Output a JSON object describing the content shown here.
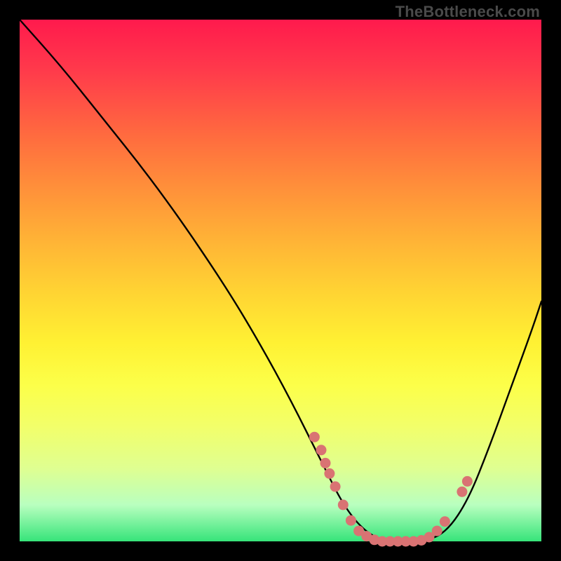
{
  "watermark": "TheBottleneck.com",
  "chart_data": {
    "type": "line",
    "title": "",
    "xlabel": "",
    "ylabel": "",
    "xlim": [
      0,
      100
    ],
    "ylim": [
      0,
      100
    ],
    "series": [
      {
        "name": "bottleneck-curve",
        "x": [
          0,
          8,
          16,
          24,
          32,
          40,
          46,
          52,
          58,
          62,
          66,
          70,
          74,
          78,
          82,
          86,
          90,
          94,
          98,
          100
        ],
        "y": [
          100,
          91,
          81,
          71,
          60,
          48,
          38,
          27,
          15,
          7,
          2,
          0,
          0,
          0,
          2,
          8,
          18,
          29,
          40,
          46
        ]
      }
    ],
    "markers": {
      "name": "highlight-dots",
      "color": "#d97373",
      "points": [
        {
          "x": 56.5,
          "y": 20.0
        },
        {
          "x": 57.8,
          "y": 17.5
        },
        {
          "x": 58.6,
          "y": 15.0
        },
        {
          "x": 59.4,
          "y": 13.0
        },
        {
          "x": 60.5,
          "y": 10.5
        },
        {
          "x": 62.0,
          "y": 7.0
        },
        {
          "x": 63.5,
          "y": 4.0
        },
        {
          "x": 65.0,
          "y": 2.0
        },
        {
          "x": 66.5,
          "y": 1.0
        },
        {
          "x": 68.0,
          "y": 0.3
        },
        {
          "x": 69.5,
          "y": 0.0
        },
        {
          "x": 71.0,
          "y": 0.0
        },
        {
          "x": 72.5,
          "y": 0.0
        },
        {
          "x": 74.0,
          "y": 0.0
        },
        {
          "x": 75.5,
          "y": 0.0
        },
        {
          "x": 77.0,
          "y": 0.2
        },
        {
          "x": 78.5,
          "y": 0.8
        },
        {
          "x": 80.0,
          "y": 2.0
        },
        {
          "x": 81.5,
          "y": 3.8
        },
        {
          "x": 84.8,
          "y": 9.5
        },
        {
          "x": 85.8,
          "y": 11.5
        }
      ]
    }
  }
}
